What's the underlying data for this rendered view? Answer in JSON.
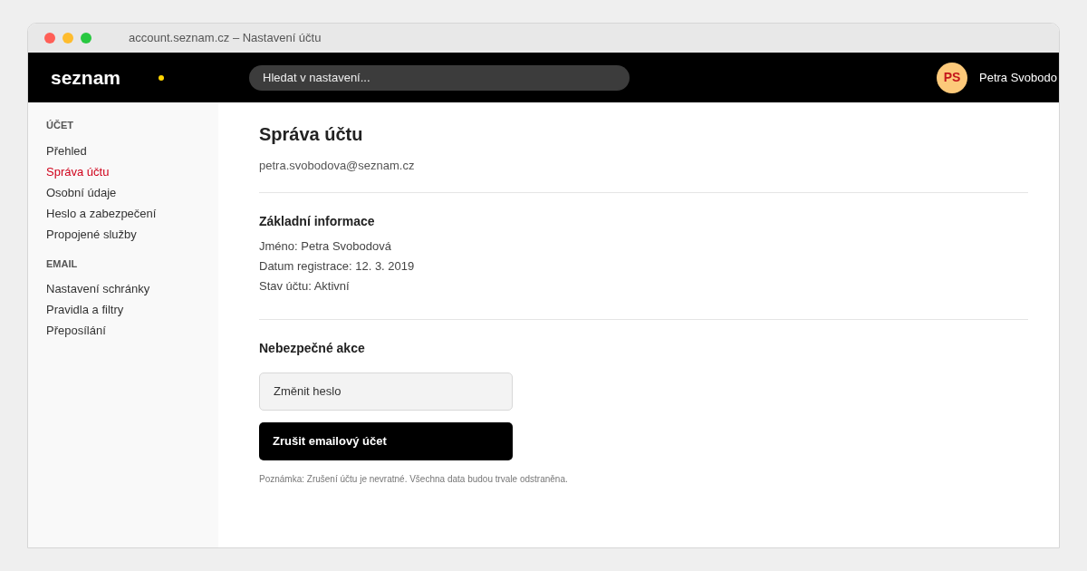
{
  "window": {
    "title": "account.seznam.cz – Nastavení účtu"
  },
  "header": {
    "logo": "seznam",
    "search": {
      "placeholder": "Hledat v nastavení..."
    },
    "user": {
      "initials": "PS",
      "name": "Petra Svobodo"
    }
  },
  "sidebar": {
    "sections": [
      {
        "heading": "ÚČET",
        "items": [
          {
            "label": "Přehled",
            "selected": false
          },
          {
            "label": "Správa účtu",
            "selected": true
          },
          {
            "label": "Osobní údaje",
            "selected": false
          },
          {
            "label": "Heslo a zabezpečení",
            "selected": false
          },
          {
            "label": "Propojené služby",
            "selected": false
          }
        ]
      },
      {
        "heading": "EMAIL",
        "items": [
          {
            "label": "Nastavení schránky",
            "selected": false
          },
          {
            "label": "Pravidla a filtry",
            "selected": false
          },
          {
            "label": "Přeposílání",
            "selected": false
          }
        ]
      }
    ]
  },
  "content": {
    "title": "Správa účtu",
    "email": "petra.svobodova@seznam.cz",
    "basic": {
      "heading": "Základní informace",
      "lines": [
        "Jméno: Petra Svobodová",
        "Datum registrace: 12. 3. 2019",
        "Stav účtu: Aktivní"
      ]
    },
    "danger": {
      "heading": "Nebezpečné akce",
      "buttons": [
        {
          "label": "Změnit heslo",
          "kind": "secondary"
        },
        {
          "label": "Zrušit emailový účet",
          "kind": "primary"
        }
      ],
      "note": "Poznámka: Zrušení účtu je nevratné. Všechna data budou trvale odstraněna."
    }
  }
}
